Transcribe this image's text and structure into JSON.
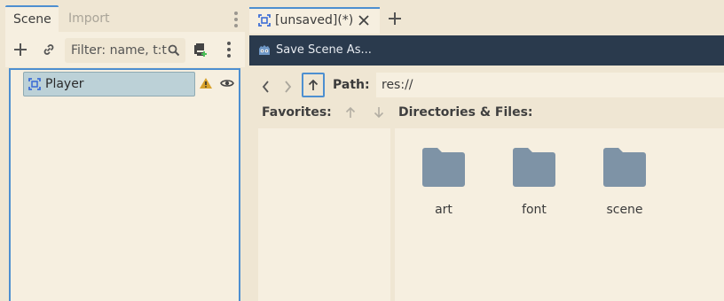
{
  "dock": {
    "tabs": [
      "Scene",
      "Import"
    ],
    "filter_placeholder": "Filter: name, t:t"
  },
  "scene_tree": {
    "nodes": [
      {
        "label": "Player",
        "warning": true,
        "visible": true
      }
    ]
  },
  "scene_tabs": {
    "tabs": [
      {
        "label": "[unsaved](*)"
      }
    ]
  },
  "dialog": {
    "title": "Save Scene As...",
    "path_label": "Path:",
    "path_value": "res://",
    "favorites_label": "Favorites:",
    "files_label": "Directories & Files:",
    "items": [
      "art",
      "font",
      "scene"
    ]
  },
  "colors": {
    "accent": "#4d8fd0",
    "title_bar": "#2a3a4d",
    "folder": "#7e93a6",
    "warning": "#d8a22c",
    "selection": "#bcd1d7"
  }
}
